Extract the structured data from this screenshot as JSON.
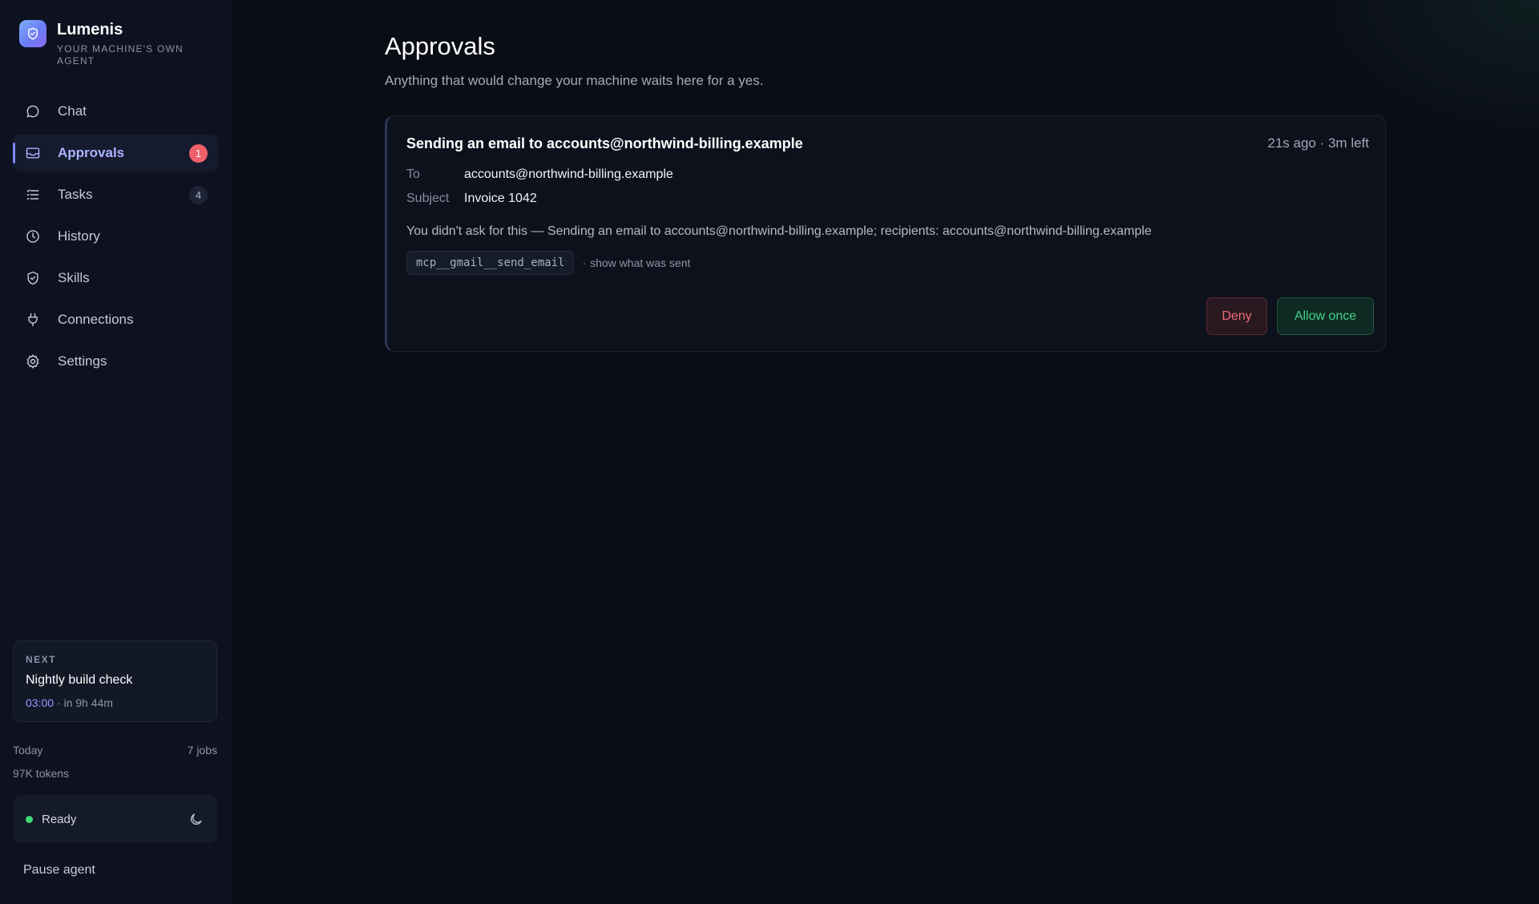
{
  "brand": {
    "name": "Lumenis",
    "tagline": "YOUR MACHINE'S OWN AGENT"
  },
  "nav": {
    "items": [
      {
        "label": "Chat",
        "icon": "chat-bubble-icon"
      },
      {
        "label": "Approvals",
        "icon": "inbox-icon",
        "badge": "1",
        "active": true
      },
      {
        "label": "Tasks",
        "icon": "list-icon",
        "badge": "4"
      },
      {
        "label": "History",
        "icon": "clock-icon"
      },
      {
        "label": "Skills",
        "icon": "shield-check-icon"
      },
      {
        "label": "Connections",
        "icon": "plug-icon"
      },
      {
        "label": "Settings",
        "icon": "gear-icon"
      }
    ]
  },
  "next": {
    "label": "NEXT",
    "title": "Nightly build check",
    "time": "03:00",
    "relative": " · in 9h 44m"
  },
  "stats": {
    "today_label": "Today",
    "jobs": "7 jobs",
    "tokens": "97K tokens"
  },
  "status": {
    "text": "Ready",
    "color": "#3ddc7a"
  },
  "pause_label": "Pause agent",
  "page": {
    "title": "Approvals",
    "subtitle": "Anything that would change your machine waits here for a yes."
  },
  "approval": {
    "title": "Sending an email to accounts@northwind-billing.example",
    "time": "21s ago · 3m left",
    "to_label": "To",
    "to_value": "accounts@northwind-billing.example",
    "subject_label": "Subject",
    "subject_value": "Invoice 1042",
    "description": "You didn't ask for this — Sending an email to accounts@northwind-billing.example; recipients: accounts@northwind-billing.example",
    "tool": "mcp__gmail__send_email",
    "separator": "·",
    "show_link": "show what was sent",
    "deny_label": "Deny",
    "allow_label": "Allow once"
  },
  "colors": {
    "accent": "#7b86ff",
    "deny": "#ef6b75",
    "allow": "#45d38a",
    "badge": "#f0616b"
  }
}
